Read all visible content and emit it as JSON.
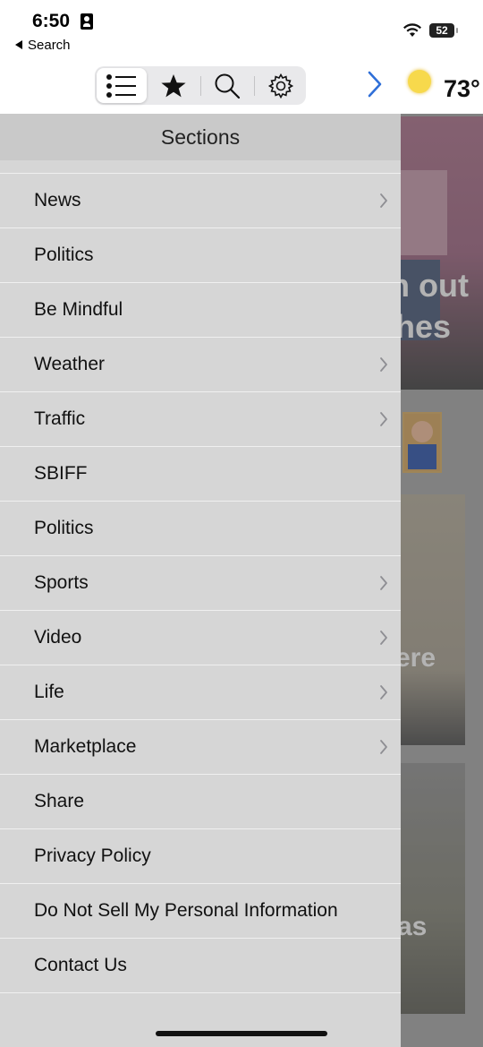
{
  "status": {
    "time": "6:50",
    "back_label": "Search",
    "battery": "52"
  },
  "toolbar": {
    "tabs": [
      {
        "icon": "list-icon",
        "active": true
      },
      {
        "icon": "star-icon",
        "active": false
      },
      {
        "icon": "search-icon",
        "active": false
      },
      {
        "icon": "gear-icon",
        "active": false
      }
    ],
    "next_icon": "chevron-right-icon"
  },
  "weather": {
    "temperature": "73°",
    "icon": "sun-icon"
  },
  "background_headlines": {
    "line1": "n out",
    "line2": "hes",
    "line3": "ere",
    "line4": "as"
  },
  "sections": {
    "title": "Sections",
    "items": [
      {
        "label": "News",
        "has_children": true
      },
      {
        "label": "Politics",
        "has_children": false
      },
      {
        "label": "Be Mindful",
        "has_children": false
      },
      {
        "label": "Weather",
        "has_children": true
      },
      {
        "label": "Traffic",
        "has_children": true
      },
      {
        "label": "SBIFF",
        "has_children": false
      },
      {
        "label": "Politics",
        "has_children": false
      },
      {
        "label": "Sports",
        "has_children": true
      },
      {
        "label": "Video",
        "has_children": true
      },
      {
        "label": "Life",
        "has_children": true
      },
      {
        "label": "Marketplace",
        "has_children": true
      },
      {
        "label": "Share",
        "has_children": false
      },
      {
        "label": "Privacy Policy",
        "has_children": false
      },
      {
        "label": "Do Not Sell My Personal Information",
        "has_children": false
      },
      {
        "label": "Contact Us",
        "has_children": false
      }
    ]
  },
  "colors": {
    "accent": "#2f6fd8",
    "drawer_bg": "#d6d6d6",
    "header_bg": "#c9c9c9"
  }
}
